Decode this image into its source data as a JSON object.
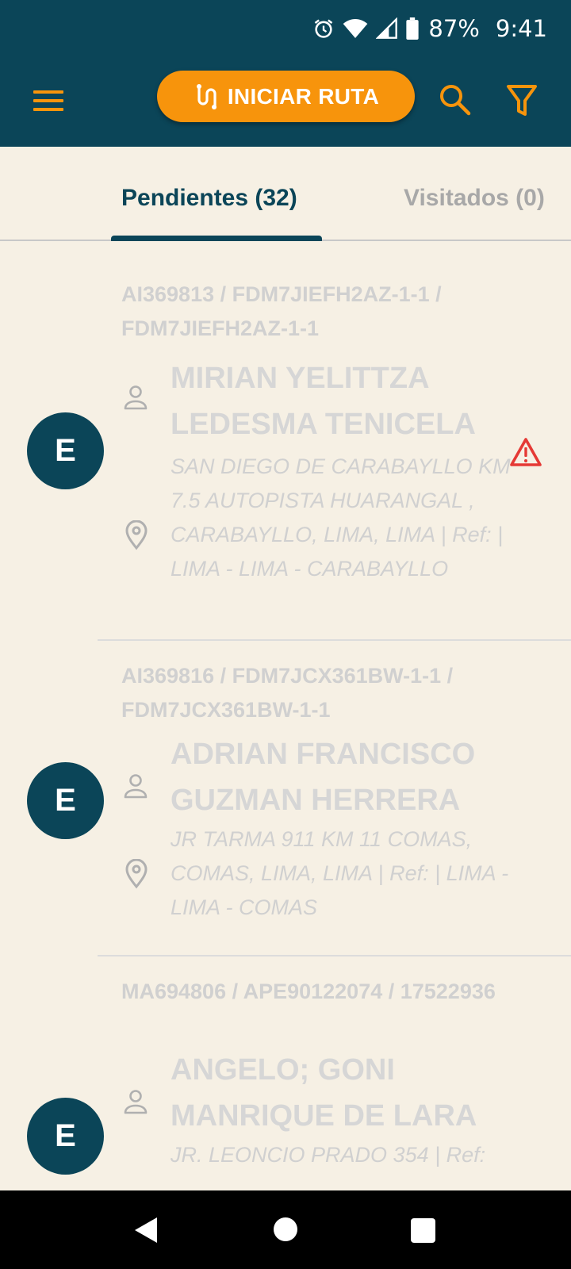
{
  "status_bar": {
    "battery": "87%",
    "time": "9:41",
    "icons": [
      "alarm-icon",
      "wifi-icon",
      "signal-icon",
      "battery-icon"
    ]
  },
  "toolbar": {
    "start_route_label": "INICIAR RUTA",
    "icons": [
      "menu-icon",
      "route-icon",
      "search-icon",
      "filter-icon"
    ]
  },
  "tabs": {
    "pending": "Pendientes (32)",
    "visited": "Visitados (0)"
  },
  "items": [
    {
      "avatar": "E",
      "codes": "AI369813 / FDM7JIEFH2AZ-1-1 / FDM7JIEFH2AZ-1-1",
      "name": "MIRIAN YELITTZA LEDESMA TENICELA",
      "address": "SAN DIEGO DE CARABAYLLO KM 7.5 AUTOPISTA HUARANGAL , CARABAYLLO, LIMA, LIMA | Ref:  | LIMA - LIMA - CARABAYLLO",
      "warning": true
    },
    {
      "avatar": "E",
      "codes": "AI369816 / FDM7JCX361BW-1-1 / FDM7JCX361BW-1-1",
      "name": "ADRIAN FRANCISCO GUZMAN HERRERA",
      "address": "JR TARMA 911 KM 11 COMAS, COMAS, LIMA, LIMA | Ref:  | LIMA - LIMA - COMAS",
      "warning": false
    },
    {
      "avatar": "E",
      "codes": "MA694806 / APE90122074 / 17522936",
      "name": "ANGELO; GONI MANRIQUE DE LARA",
      "address": "JR. LEONCIO PRADO 354 | Ref:",
      "warning": false
    }
  ],
  "colors": {
    "primary": "#0b4558",
    "accent": "#f7940c",
    "background": "#f6f0e4",
    "warning": "#e53935"
  }
}
